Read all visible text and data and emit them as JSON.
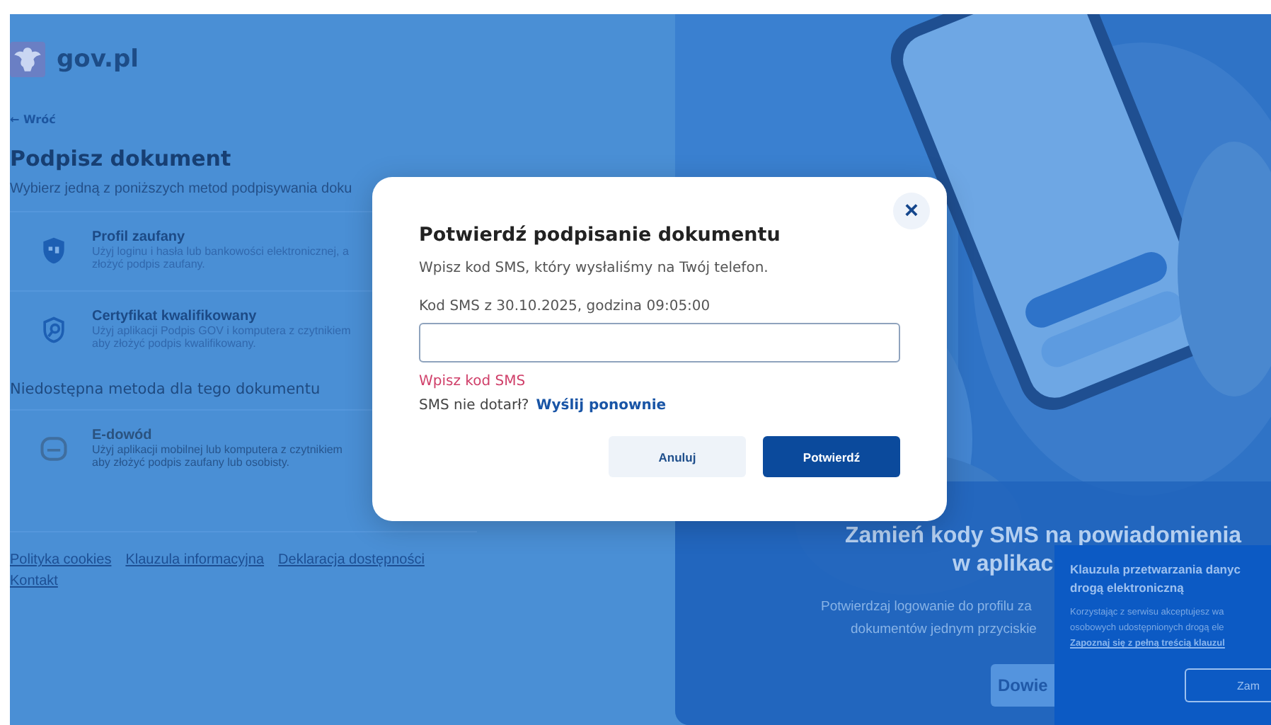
{
  "header": {
    "logo_text": "gov.pl"
  },
  "back_link": "← Wróć",
  "page_title": "Podpisz dokument",
  "intro": "Wybierz jedną z poniższych metod podpisywania doku",
  "methods": [
    {
      "title": "Profil zaufany",
      "lines": [
        "Użyj loginu i hasła lub bankowości elektronicznej, a",
        "złożyć podpis zaufany."
      ],
      "disabled": false
    },
    {
      "title": "Certyfikat kwalifikowany",
      "lines": [
        "Użyj aplikacji Podpis GOV i komputera z czytnikiem",
        "aby złożyć podpis kwalifikowany."
      ],
      "disabled": false
    }
  ],
  "unavailable_heading": "Niedostępna metoda dla tego dokumentu",
  "unavailable_methods": [
    {
      "title": "E-dowód",
      "lines": [
        "Użyj aplikacji mobilnej lub komputera z czytnikiem",
        "aby złożyć podpis zaufany lub osobisty."
      ],
      "disabled": true
    }
  ],
  "footer_links": [
    "Polityka cookies",
    "Klauzula informacyjna",
    "Deklaracja dostępności",
    "Kontakt"
  ],
  "promo": {
    "heading_lines": [
      "Zamień kody SMS na powiadomienia",
      "w aplikac"
    ],
    "text_lines": [
      "Potwierdzaj logowanie do profilu za",
      "dokumentów jednym przyciskie"
    ],
    "button": "Dowie"
  },
  "cookie_notice": {
    "title_lines": [
      "Klauzula przetwarzania danyc",
      "drogą elektroniczną"
    ],
    "text_lines": [
      "Korzystając z serwisu akceptujesz wa",
      "osobowych udostępnionych drogą ele"
    ],
    "link": "Zapoznaj się z pełną treścią klauzul",
    "button": "Zam"
  },
  "dialog": {
    "title": "Potwierdź podpisanie dokumentu",
    "subtitle": "Wpisz kod SMS, który wysłaliśmy na Twój telefon.",
    "field_label": "Kod SMS z 30.10.2025, godzina 09:05:00",
    "error": "Wpisz kod SMS",
    "resend_prompt": "SMS nie dotarł?",
    "resend_link": "Wyślij ponownie",
    "close": "×",
    "buttons": [
      {
        "label": "Anuluj",
        "kind": "secondary"
      },
      {
        "label": "Potwierdź",
        "kind": "primary"
      }
    ]
  }
}
